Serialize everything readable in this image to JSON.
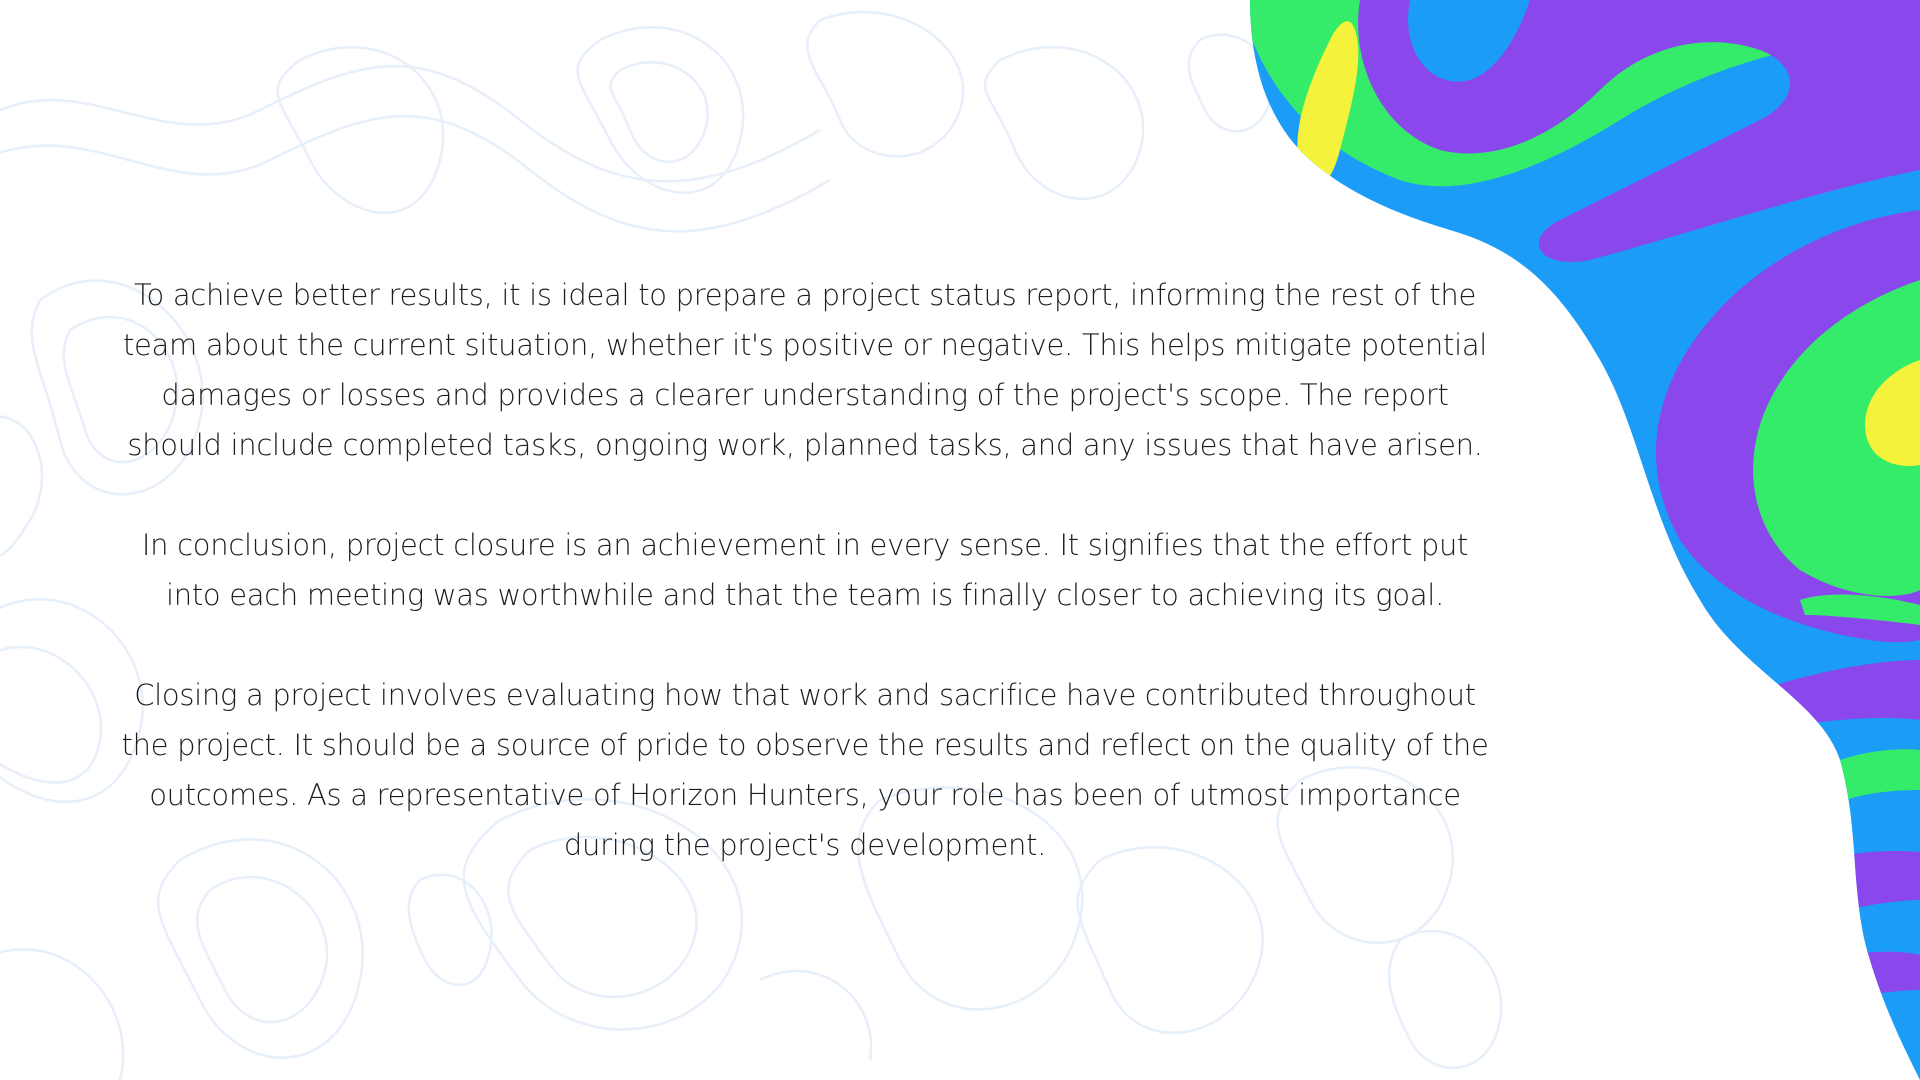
{
  "slide": {
    "paragraphs": [
      "To achieve better results, it is ideal to prepare a project status report, informing the rest of the team about the current situation, whether it's positive or negative. This helps mitigate potential damages or losses and provides a clearer understanding of the project's scope. The report should include completed tasks, ongoing work, planned tasks, and any issues that have arisen.",
      "In conclusion, project closure is an achievement in every sense. It signifies that the effort put into each meeting was worthwhile and that the team is finally closer to achieving its goal.",
      "Closing a project involves evaluating how that work and sacrifice have contributed throughout the project. It should be a source of pride to observe the results and reflect on the quality of the outcomes. As a representative of Horizon Hunters, your role has been of utmost importance during the project's development."
    ]
  },
  "colors": {
    "background": "#ffffff",
    "text": "#1c1c1c",
    "topo_lines": "#e6effa",
    "blob_blue": "#1a9cf7",
    "blob_purple": "#8a48ec",
    "blob_green": "#34ec6a",
    "blob_yellow": "#f4f23a"
  }
}
